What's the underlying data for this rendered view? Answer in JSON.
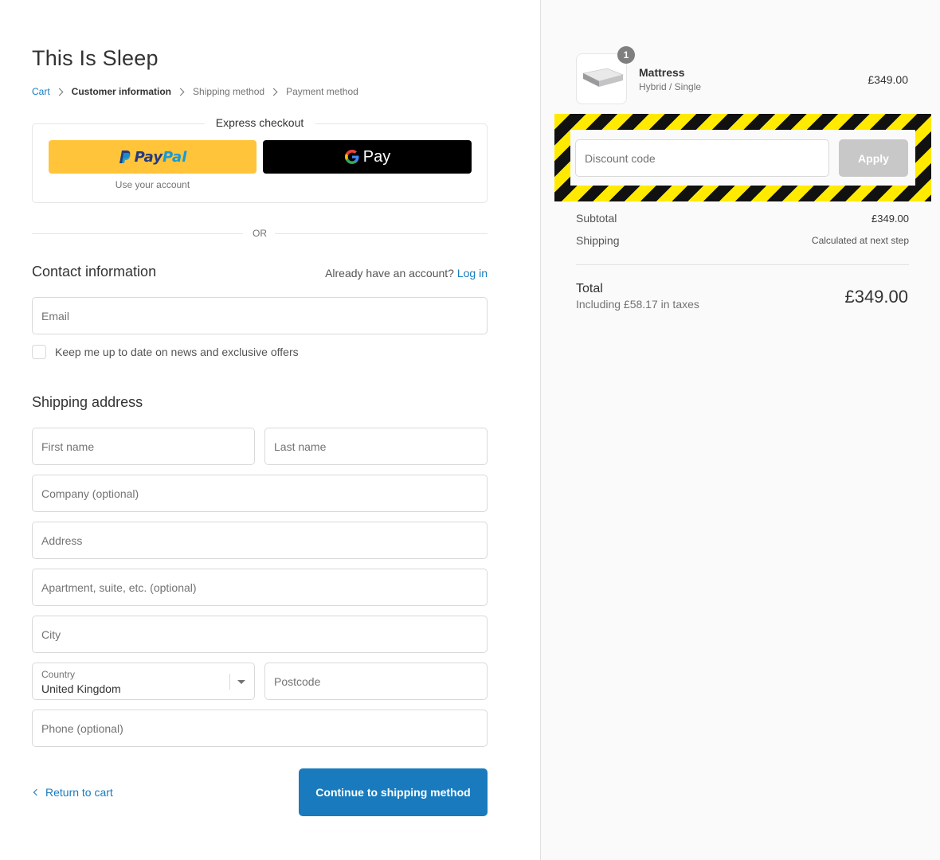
{
  "shop": {
    "title": "This Is Sleep"
  },
  "breadcrumb": [
    {
      "label": "Cart"
    },
    {
      "label": "Customer information"
    },
    {
      "label": "Shipping method"
    },
    {
      "label": "Payment method"
    }
  ],
  "express": {
    "title": "Express checkout",
    "paypal_label_a": "Pay",
    "paypal_label_b": "Pal",
    "paypal_sub": "Use your account",
    "gpay_label": "Pay"
  },
  "or_label": "OR",
  "contact": {
    "title": "Contact information",
    "account_prompt": "Already have an account?",
    "login_label": "Log in",
    "email_placeholder": "Email",
    "newsletter_label": "Keep me up to date on news and exclusive offers"
  },
  "shipping": {
    "title": "Shipping address",
    "first_name_placeholder": "First name",
    "last_name_placeholder": "Last name",
    "company_placeholder": "Company (optional)",
    "address_placeholder": "Address",
    "apartment_placeholder": "Apartment, suite, etc. (optional)",
    "city_placeholder": "City",
    "country_label": "Country",
    "country_value": "United Kingdom",
    "postcode_placeholder": "Postcode",
    "phone_placeholder": "Phone (optional)"
  },
  "footer": {
    "return_label": "Return to cart",
    "continue_label": "Continue to shipping method"
  },
  "order": {
    "product": {
      "quantity": "1",
      "name": "Mattress",
      "variant": "Hybrid / Single",
      "price": "£349.00"
    },
    "discount_placeholder": "Discount code",
    "apply_label": "Apply",
    "subtotal_label": "Subtotal",
    "subtotal_value": "£349.00",
    "shipping_label": "Shipping",
    "shipping_value": "Calculated at next step",
    "total_label": "Total",
    "tax_note": "Including £58.17 in taxes",
    "total_value": "£349.00"
  },
  "colors": {
    "accent": "#197bbd",
    "paypal_yellow": "#ffc439",
    "hazard_yellow": "#ffea00"
  }
}
